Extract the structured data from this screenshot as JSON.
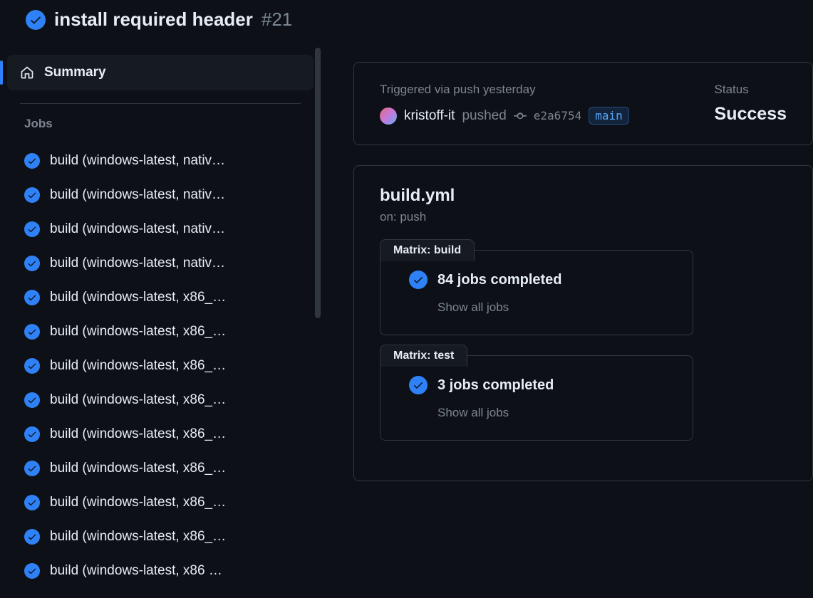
{
  "header": {
    "title": "install required header",
    "run_number": "#21"
  },
  "sidebar": {
    "summary_label": "Summary",
    "jobs_heading": "Jobs",
    "jobs": [
      "build (windows-latest, nativ…",
      "build (windows-latest, nativ…",
      "build (windows-latest, nativ…",
      "build (windows-latest, nativ…",
      "build (windows-latest, x86_…",
      "build (windows-latest, x86_…",
      "build (windows-latest, x86_…",
      "build (windows-latest, x86_…",
      "build (windows-latest, x86_…",
      "build (windows-latest, x86_…",
      "build (windows-latest, x86_…",
      "build (windows-latest, x86_…",
      "build (windows-latest, x86 …"
    ]
  },
  "info": {
    "trigger_label": "Triggered via push yesterday",
    "author": "kristoff-it",
    "pushed_text": "pushed",
    "sha": "e2a6754",
    "branch": "main",
    "status_label": "Status",
    "status_value": "Success"
  },
  "workflow": {
    "file": "build.yml",
    "on_text": "on: push",
    "matrices": [
      {
        "name": "Matrix: build",
        "completed_text": "84 jobs completed",
        "show_all": "Show all jobs"
      },
      {
        "name": "Matrix: test",
        "completed_text": "3 jobs completed",
        "show_all": "Show all jobs"
      }
    ]
  }
}
